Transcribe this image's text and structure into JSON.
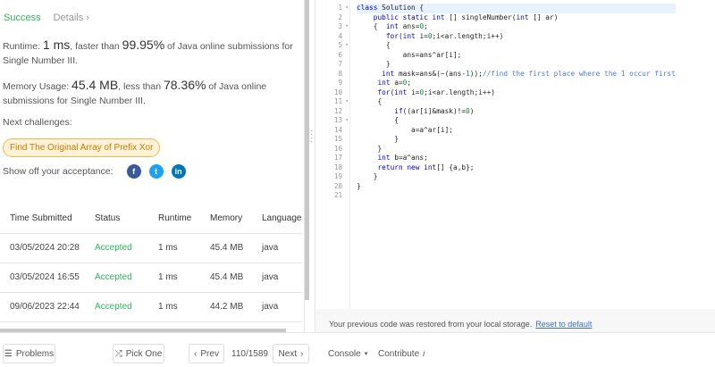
{
  "tabs": {
    "success": "Success",
    "details": "Details",
    "details_icon": "›"
  },
  "runtime": {
    "label": "Runtime: ",
    "value": "1 ms",
    "middle": ", faster than ",
    "percent": "99.95%",
    "suffix": " of Java online submissions for Single Number III."
  },
  "memory": {
    "label": "Memory Usage: ",
    "value": "45.4 MB",
    "middle": ", less than ",
    "percent": "78.36%",
    "suffix": " of Java online submissions for Single Number III."
  },
  "next_challenges": {
    "label": "Next challenges:",
    "item": "Find The Original Array of Prefix Xor"
  },
  "share": {
    "label": "Show off your acceptance:",
    "facebook": "f",
    "twitter": "t",
    "linkedin": "in"
  },
  "submissions": {
    "headers": [
      "Time Submitted",
      "Status",
      "Runtime",
      "Memory",
      "Language"
    ],
    "rows": [
      [
        "03/05/2024 20:28",
        "Accepted",
        "1 ms",
        "45.4 MB",
        "java"
      ],
      [
        "03/05/2024 16:55",
        "Accepted",
        "1 ms",
        "45.4 MB",
        "java"
      ],
      [
        "09/06/2023 22:44",
        "Accepted",
        "1 ms",
        "44.2 MB",
        "java"
      ]
    ]
  },
  "code_lines": [
    "class Solution {",
    "    public static int [] singleNumber(int [] ar)",
    "    {  int ans=0;",
    "       for(int i=0;i<ar.length;i++)",
    "       {",
    "           ans=ans^ar[i];",
    "       }",
    "      int mask=ans&(~(ans-1));//find the first place where the 1 occur first",
    "     int a=0;",
    "     for(int i=0;i<ar.length;i++)",
    "     {",
    "         if((ar[i]&mask)!=0)",
    "         {",
    "             a=a^ar[i];",
    "         }",
    "     }",
    "     int b=a^ans;",
    "     return new int[] {a,b};",
    "    }",
    "}",
    ""
  ],
  "fold_lines": [
    1,
    3,
    5,
    11,
    13
  ],
  "restore": {
    "text": "Your previous code was restored from your local storage.",
    "link": "Reset to default"
  },
  "footer": {
    "problems": "Problems",
    "pick_one": "Pick One",
    "prev": "Prev",
    "page": "110/1589",
    "next": "Next",
    "console": "Console",
    "contribute": "Contribute",
    "contribute_icon": "i"
  },
  "colors": {
    "success": "#2db55d",
    "challenge_bg": "#fdf1d8",
    "challenge_border": "#f0b849",
    "link": "#3a6fcf"
  }
}
